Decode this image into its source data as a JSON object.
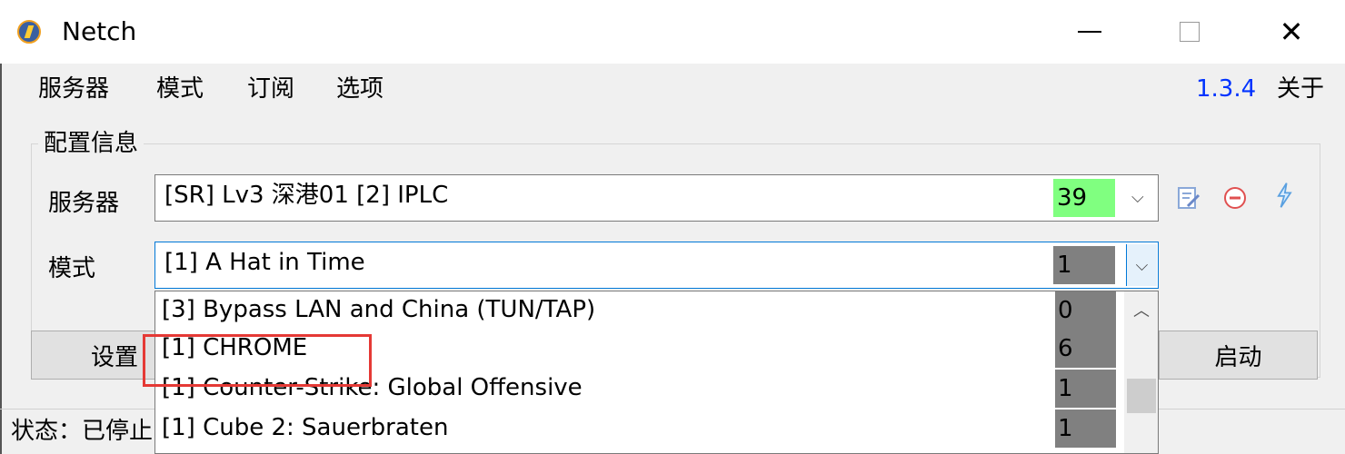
{
  "window": {
    "title": "Netch",
    "icon": "netch-logo-icon",
    "minimize_glyph": "─",
    "maximize_glyph": "☐",
    "close_glyph": "✕"
  },
  "menu": {
    "items": [
      "服务器",
      "模式",
      "订阅",
      "选项"
    ],
    "version": "1.3.4",
    "about": "关于"
  },
  "config": {
    "group_title": "配置信息",
    "server_label": "服务器",
    "server_value": "[SR] Lv3 深港01  [2] IPLC",
    "server_latency": "39",
    "server_latency_color": "#80ff80",
    "mode_label": "模式",
    "mode_value": "[1] A Hat in Time",
    "mode_count": "1",
    "mode_count_color": "#808080",
    "icons": [
      "edit-icon",
      "remove-icon",
      "speedtest-lightning-icon"
    ]
  },
  "buttons": {
    "settings": "设置",
    "start": "启动"
  },
  "status": {
    "text": "状态：已停止"
  },
  "dropdown": {
    "options": [
      {
        "label": "[3] Bypass LAN and China (TUN/TAP)",
        "count": "0"
      },
      {
        "label": "[1] CHROME",
        "count": "6"
      },
      {
        "label": "[1] Counter-Strike: Global Offensive",
        "count": "1"
      },
      {
        "label": "[1] Cube 2: Sauerbraten",
        "count": "1"
      }
    ],
    "highlight_color": "#e53935"
  }
}
